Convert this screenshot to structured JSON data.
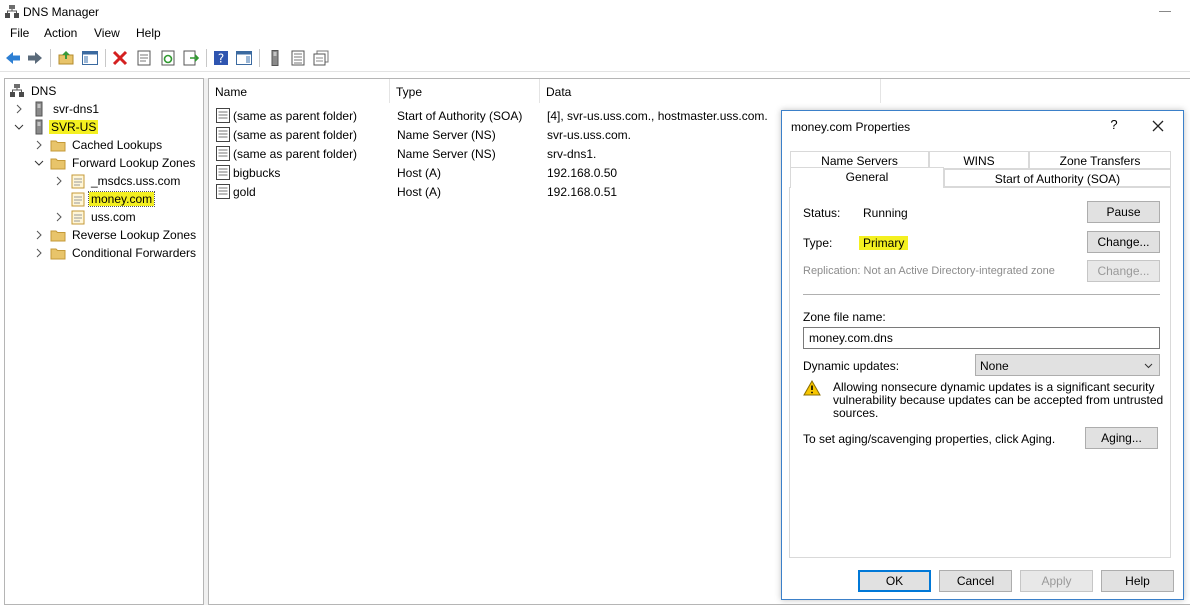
{
  "window": {
    "title": "DNS Manager"
  },
  "menu": [
    "File",
    "Action",
    "View",
    "Help"
  ],
  "toolbar": {
    "icons": [
      "back-arrow-icon",
      "forward-arrow-icon",
      "up-folder-icon",
      "show-hide-console-tree-icon",
      "delete-icon",
      "properties-icon",
      "refresh-icon",
      "export-list-icon",
      "help-icon",
      "show-action-pane-icon",
      "server-icon",
      "records-icon",
      "new-window-icon"
    ]
  },
  "tree": {
    "root": "DNS",
    "server1": "svr-dns1",
    "server2": "SVR-US",
    "cached": "Cached Lookups",
    "forward": "Forward Lookup Zones",
    "zone_msdcs": "_msdcs.uss.com",
    "zone_money": "money.com",
    "zone_uss": "uss.com",
    "reverse": "Reverse Lookup Zones",
    "conditional": "Conditional Forwarders"
  },
  "list": {
    "columns": [
      "Name",
      "Type",
      "Data"
    ],
    "rows": [
      {
        "name": "(same as parent folder)",
        "type": "Start of Authority (SOA)",
        "data": "[4], svr-us.uss.com., hostmaster.uss.com."
      },
      {
        "name": "(same as parent folder)",
        "type": "Name Server (NS)",
        "data": "svr-us.uss.com."
      },
      {
        "name": "(same as parent folder)",
        "type": "Name Server (NS)",
        "data": "srv-dns1."
      },
      {
        "name": "bigbucks",
        "type": "Host (A)",
        "data": "192.168.0.50"
      },
      {
        "name": "gold",
        "type": "Host (A)",
        "data": "192.168.0.51"
      }
    ]
  },
  "dialog": {
    "title": "money.com Properties",
    "help_glyph": "?",
    "tabs_row1": [
      "Name Servers",
      "WINS",
      "Zone Transfers"
    ],
    "tabs_row2": [
      "General",
      "Start of Authority (SOA)"
    ],
    "status_label": "Status:",
    "status_value": "Running",
    "pause_button": "Pause",
    "type_label": "Type:",
    "type_value": "Primary",
    "change_button": "Change...",
    "replication_text": "Replication:  Not an Active Directory-integrated zone",
    "change_button2": "Change...",
    "zone_file_label": "Zone file name:",
    "zone_file_value": "money.com.dns",
    "dynamic_label": "Dynamic updates:",
    "dynamic_value": "None",
    "warning_line1": "Allowing nonsecure dynamic updates is a significant security",
    "warning_line2": "vulnerability because updates can be accepted from untrusted",
    "warning_line3": "sources.",
    "aging_text": "To set aging/scavenging properties, click Aging.",
    "aging_button": "Aging...",
    "ok": "OK",
    "cancel": "Cancel",
    "apply": "Apply",
    "help": "Help"
  },
  "colors": {
    "highlight": "#f4f020",
    "accent": "#0078d7",
    "folder": "#e8c46a"
  }
}
